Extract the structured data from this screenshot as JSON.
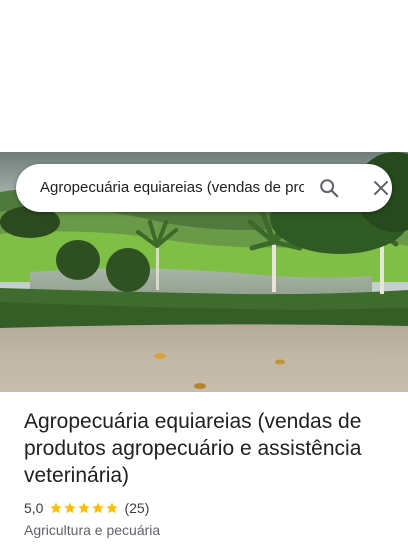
{
  "search": {
    "query": "Agropecuária equiareias (vendas de produtos agropecuário e assistência veterinária)"
  },
  "icons": {
    "search": "search-icon",
    "close": "close-icon",
    "star": "star-icon"
  },
  "place": {
    "title": "Agropecuária equiareias (vendas de produtos agropecuário e assistência veterinária)",
    "rating": "5,0",
    "stars": 5,
    "review_count": "(25)",
    "category": "Agricultura e pecuária"
  },
  "colors": {
    "star": "#fbbc04",
    "icon": "#5f6368",
    "text_primary": "#202124",
    "text_secondary": "#5f6368"
  }
}
